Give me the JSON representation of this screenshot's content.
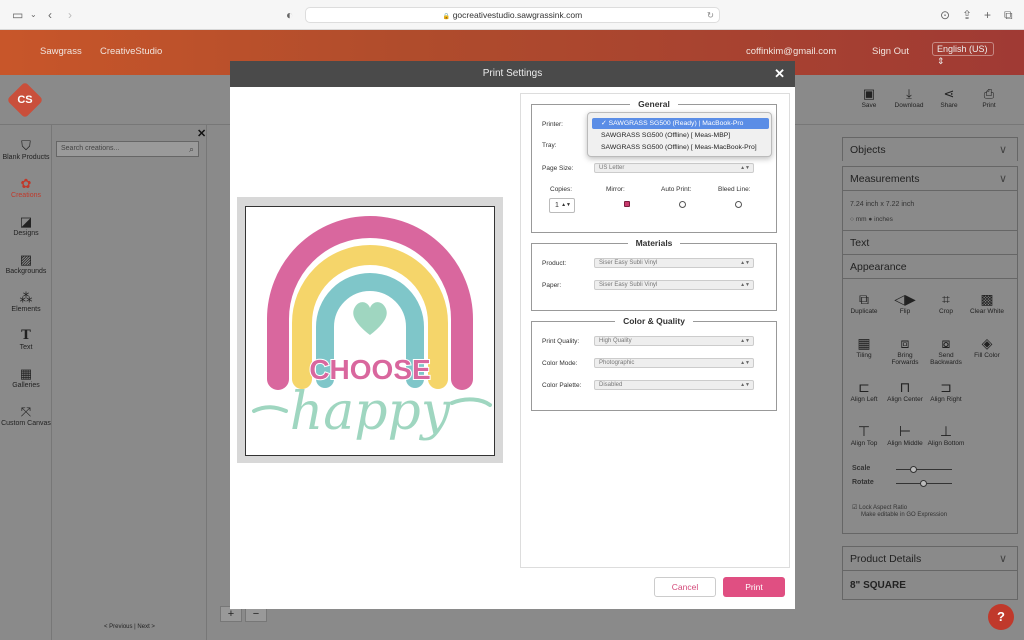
{
  "browser": {
    "url": "gocreativestudio.sawgrassink.com",
    "url_prefix": "🔒"
  },
  "header": {
    "brand": "Sawgrass",
    "product": "CreativeStudio",
    "email": "coffinkim@gmail.com",
    "signout": "Sign Out",
    "language": "English (US)"
  },
  "logo": "CS",
  "toolbar": [
    {
      "label": "Save",
      "icon": "save-icon",
      "glyph": "💾"
    },
    {
      "label": "Download",
      "icon": "download-icon",
      "glyph": "⤓"
    },
    {
      "label": "Share",
      "icon": "share-icon",
      "glyph": "⋖"
    },
    {
      "label": "Print",
      "icon": "printer-icon",
      "glyph": "🖶"
    }
  ],
  "nav": [
    {
      "label": "Blank Products",
      "glyph": "👕"
    },
    {
      "label": "Creations",
      "glyph": "✿",
      "active": true
    },
    {
      "label": "Designs",
      "glyph": "◪"
    },
    {
      "label": "Backgrounds",
      "glyph": "▨"
    },
    {
      "label": "Elements",
      "glyph": "⁂"
    },
    {
      "label": "Text",
      "glyph": "T"
    },
    {
      "label": "Galleries",
      "glyph": "▦"
    },
    {
      "label": "Custom Canvas",
      "glyph": "⤧"
    }
  ],
  "creations": {
    "search_placeholder": "Search creations...",
    "pager": "< Previous | Next >"
  },
  "right": {
    "objects": "Objects",
    "measurements": "Measurements",
    "size": "7.24 inch x 7.22 inch",
    "units_mm": "mm",
    "units_inches": "inches",
    "text": "Text",
    "appearance": "Appearance",
    "tools_row1": [
      "Duplicate",
      "Flip",
      "Crop",
      "Clear White"
    ],
    "tools_row2": [
      "Tiling",
      "Bring Forwards",
      "Send Backwards",
      "Fill Color"
    ],
    "tools_row3": [
      "Align Left",
      "Align Center",
      "Align Right"
    ],
    "tools_row4": [
      "Align Top",
      "Align Middle",
      "Align Bottom"
    ],
    "scale": "Scale",
    "rotate": "Rotate",
    "lock": "Lock Aspect Ratio",
    "lock_note": "Make editable in GO Expression",
    "product_details": "Product Details",
    "product": "8\" SQUARE"
  },
  "modal": {
    "title": "Print Settings",
    "general": "General",
    "printer_label": "Printer:",
    "printer_options": [
      "✓ SAWGRASS SG500 (Ready) | MacBook-Pro",
      "SAWGRASS SG500 (Offline) [ Meas-MBP]",
      "SAWGRASS SG500 (Offline) [ Meas-MacBook-Pro]"
    ],
    "tray_label": "Tray:",
    "page_size_label": "Page Size:",
    "page_size": "US Letter",
    "copies_label": "Copies:",
    "copies": "1",
    "mirror_label": "Mirror:",
    "auto_print_label": "Auto Print:",
    "bleed_line_label": "Bleed Line:",
    "materials": "Materials",
    "product_label": "Product:",
    "product": "Siser Easy Subli Vinyl",
    "paper_label": "Paper:",
    "paper": "Siser Easy Subli Vinyl",
    "color_quality": "Color & Quality",
    "quality_label": "Print Quality:",
    "quality": "High Quality",
    "mode_label": "Color Mode:",
    "mode": "Photographic",
    "palette_label": "Color Palette:",
    "palette": "Disabled",
    "cancel": "Cancel",
    "print": "Print"
  },
  "artwork": {
    "word1": "CHOOSE",
    "word2": "happy"
  },
  "colors": {
    "pink": "#d9679e",
    "yellow": "#f5d56a",
    "teal": "#7fc6c9",
    "mint": "#9fd6c0",
    "accent": "#e04f82"
  }
}
